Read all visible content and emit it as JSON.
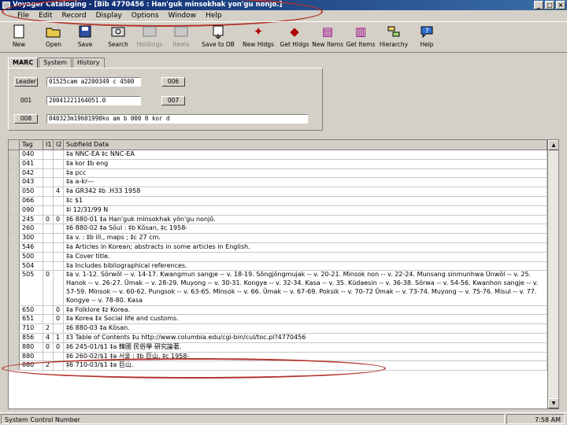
{
  "window": {
    "title": "Voyager Cataloging - [Bib 4770456 : Han'guk minsokhak yon'gu nonjo.]",
    "controls": [
      "_",
      "□",
      "×"
    ]
  },
  "menu": [
    "File",
    "Edit",
    "Record",
    "Display",
    "Options",
    "Window",
    "Help"
  ],
  "toolbar": [
    {
      "label": "New",
      "icon": "new-document-icon"
    },
    {
      "label": "Open",
      "icon": "open-folder-icon"
    },
    {
      "label": "Save",
      "icon": "save-disk-icon"
    },
    {
      "label": "Search",
      "icon": "search-binoculars-icon"
    },
    {
      "label": "Holdings",
      "icon": "holdings-icon"
    },
    {
      "label": "Items",
      "icon": "items-icon"
    },
    {
      "label": "Save to DB",
      "icon": "save-to-db-icon"
    },
    {
      "label": "New Hldgs",
      "icon": "new-holdings-icon"
    },
    {
      "label": "Get Hldgs",
      "icon": "get-holdings-icon"
    },
    {
      "label": "New Items",
      "icon": "new-items-icon"
    },
    {
      "label": "Get Items",
      "icon": "get-items-icon"
    },
    {
      "label": "Hierarchy",
      "icon": "hierarchy-icon"
    },
    {
      "label": "Help",
      "icon": "help-icon"
    }
  ],
  "tabs": [
    "MARC",
    "System",
    "History"
  ],
  "leader": {
    "rows": [
      {
        "button": "Leader",
        "value": "01525cam a2200349 c 4500",
        "extra": "006"
      },
      {
        "button": "001",
        "value": "20041221164051.0",
        "extra": "007"
      },
      {
        "button": "008",
        "value": "040323m19601990ko   am     b    000 0 kor d"
      }
    ]
  },
  "grid": {
    "headers": [
      "Tag",
      "I1",
      "I2",
      "Subfield Data"
    ],
    "rows": [
      {
        "tag": "040",
        "i1": "",
        "i2": "",
        "data": "‡a NNC-EA ‡c NNC-EA"
      },
      {
        "tag": "041",
        "i1": "",
        "i2": "",
        "data": "‡a kor ‡b eng"
      },
      {
        "tag": "042",
        "i1": "",
        "i2": "",
        "data": "‡a pcc"
      },
      {
        "tag": "043",
        "i1": "",
        "i2": "",
        "data": "‡a a-kr---"
      },
      {
        "tag": "050",
        "i1": "",
        "i2": "4",
        "data": "‡a GR342 ‡b .H33 1958"
      },
      {
        "tag": "066",
        "i1": "",
        "i2": "",
        "data": "‡c $1"
      },
      {
        "tag": "090",
        "i1": "",
        "i2": "",
        "data": "‡i 12/31/99 N"
      },
      {
        "tag": "245",
        "i1": "0",
        "i2": "0",
        "data": "‡6 880-01 ‡a Han'guk minsokhak yŏn'gu nonjŏ."
      },
      {
        "tag": "260",
        "i1": "",
        "i2": "",
        "data": "‡6 880-02 ‡a Sŏul : ‡b Kŏsan, ‡c 1958-"
      },
      {
        "tag": "300",
        "i1": "",
        "i2": "",
        "data": "‡a v. : ‡b ill., maps ; ‡c 27 cm."
      },
      {
        "tag": "546",
        "i1": "",
        "i2": "",
        "data": "‡a Articles in Korean; abstracts in some articles in English."
      },
      {
        "tag": "500",
        "i1": "",
        "i2": "",
        "data": "‡a Cover title."
      },
      {
        "tag": "504",
        "i1": "",
        "i2": "",
        "data": "‡a Includes bibliographical references."
      },
      {
        "tag": "505",
        "i1": "0",
        "i2": "",
        "data": "‡a v. 1-12. Sŏrwŏl -- v. 14-17. Kwangmun sangje -- v. 18-19. Sŏngjŏngmujak -- v. 20-21. Minsok non -- v. 22-24. Munsang sinmunhwa Ŭnwŏl -- v. 25. Hanok -- v. 26-27. Ŭmak -- v. 28-29. Muyong -- v. 30-31. Kongye -- v. 32-34. Kasa -- v. 35. Kŭdaesin -- v. 36-38. Sŏrwa -- v. 54-56. Kwanhon sangje -- v. 57-59. Minsok -- v. 60-62. Pungsok -- v. 63-65. Minsok -- v. 66. Ŭmak -- v. 67-69. Poksik -- v. 70-72 Ŭmak -- v. 73-74. Muyong -- v. 75-76. Misul -- v. 77. Kongye -- v. 78-80. Kasa"
      },
      {
        "tag": "650",
        "i1": "",
        "i2": "0",
        "data": "‡a Folklore ‡z Korea."
      },
      {
        "tag": "651",
        "i1": "",
        "i2": "0",
        "data": "‡a Korea ‡x Social life and customs."
      },
      {
        "tag": "710",
        "i1": "2",
        "i2": "",
        "data": "‡6 880-03 ‡a Kŏsan."
      },
      {
        "tag": "856",
        "i1": "4",
        "i2": "1",
        "data": "‡3 Table of Contents ‡u http://www.columbia.edu/cgi-bin/cul/toc.pl?4770456"
      },
      {
        "tag": "880",
        "i1": "0",
        "i2": "0",
        "data": "‡6 245-01/$1 ‡a 韓國 民俗學 硏究論著."
      },
      {
        "tag": "880",
        "i1": "",
        "i2": "",
        "data": "‡6 260-02/$1 ‡a 서울 : ‡b 巨山, ‡c 1958-"
      },
      {
        "tag": "880",
        "i1": "2",
        "i2": "",
        "data": "‡6 710-03/$1 ‡a 巨山."
      }
    ]
  },
  "status": {
    "left": "System Control Number",
    "right": "7:58 AM"
  },
  "colors": {
    "title_bar": "#0a246a",
    "annotation": "#b2342a"
  }
}
